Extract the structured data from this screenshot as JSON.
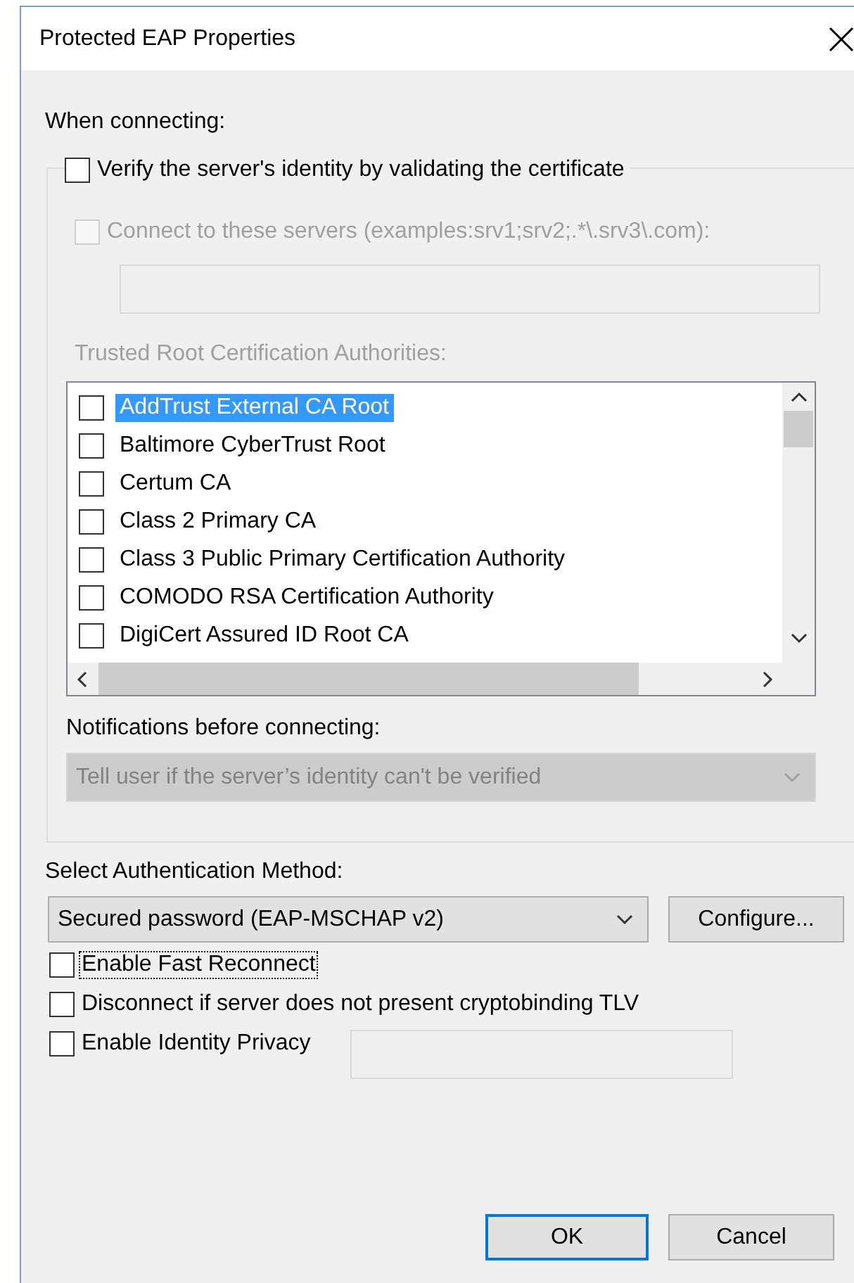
{
  "window": {
    "title": "Protected EAP Properties"
  },
  "heading": "When connecting:",
  "verify": {
    "label": "Verify the server's identity by validating the certificate",
    "checked": false
  },
  "connect_servers": {
    "label": "Connect to these servers (examples:srv1;srv2;.*\\.srv3\\.com):",
    "checked": false,
    "disabled": true
  },
  "trusted_label": "Trusted Root Certification Authorities:",
  "certificates": [
    {
      "name": "AddTrust External CA Root",
      "checked": false,
      "selected": true
    },
    {
      "name": "Baltimore CyberTrust Root",
      "checked": false,
      "selected": false
    },
    {
      "name": "Certum CA",
      "checked": false,
      "selected": false
    },
    {
      "name": "Class 2 Primary CA",
      "checked": false,
      "selected": false
    },
    {
      "name": "Class 3 Public Primary Certification Authority",
      "checked": false,
      "selected": false
    },
    {
      "name": "COMODO RSA Certification Authority",
      "checked": false,
      "selected": false
    },
    {
      "name": "DigiCert Assured ID Root CA",
      "checked": false,
      "selected": false
    }
  ],
  "notifications": {
    "label": "Notifications before connecting:",
    "value": "Tell user if the server’s identity can't be verified",
    "disabled": true
  },
  "auth_method": {
    "label": "Select Authentication Method:",
    "value": "Secured password (EAP-MSCHAP v2)",
    "configure": "Configure..."
  },
  "options": [
    {
      "label": "Enable Fast Reconnect",
      "checked": false,
      "focused": true
    },
    {
      "label": "Disconnect if server does not present cryptobinding TLV",
      "checked": false,
      "focused": false
    },
    {
      "label": "Enable Identity Privacy",
      "checked": false,
      "focused": false
    }
  ],
  "buttons": [
    {
      "label": "OK",
      "default": true
    },
    {
      "label": "Cancel",
      "default": false
    }
  ]
}
